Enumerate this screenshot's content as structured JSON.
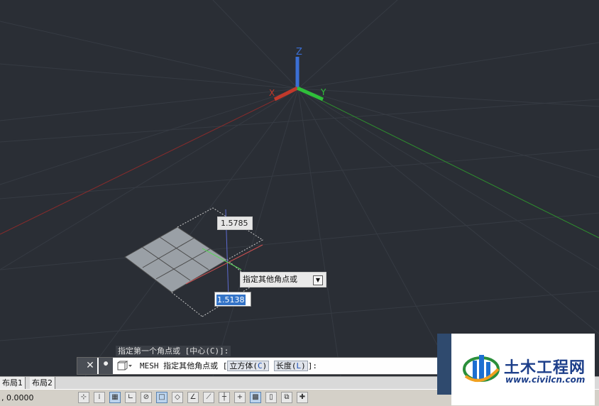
{
  "viewport": {
    "axis_labels": {
      "z": "Z",
      "x": "X",
      "y": "Y"
    },
    "dim_length": "1.5785",
    "tooltip_prompt": "指定其他角点或",
    "dim_width_input": "1.5138"
  },
  "command": {
    "history_line": "指定第一个角点或 [中心(C)]:",
    "close_glyph": "✕",
    "cmd_name": "MESH",
    "prompt": "指定其他角点或",
    "bracket_open": "[",
    "option1_text": "立方体(",
    "option1_key": "C",
    "option1_end": ")",
    "option2_text": "长度(",
    "option2_key": "L",
    "option2_end": ")",
    "bracket_close": "]:"
  },
  "layout_tabs": [
    "布局1",
    "布局2"
  ],
  "status": {
    "coords": ", 0.0000"
  },
  "watermark": {
    "name": "土木工程网",
    "url": "www.civilcn.com"
  },
  "colors": {
    "x_axis": "#c0392b",
    "y_axis": "#2fbf3a",
    "z_axis": "#3b6fd4",
    "grid": "#353a42",
    "mesh_fill": "#9aa0a6"
  }
}
